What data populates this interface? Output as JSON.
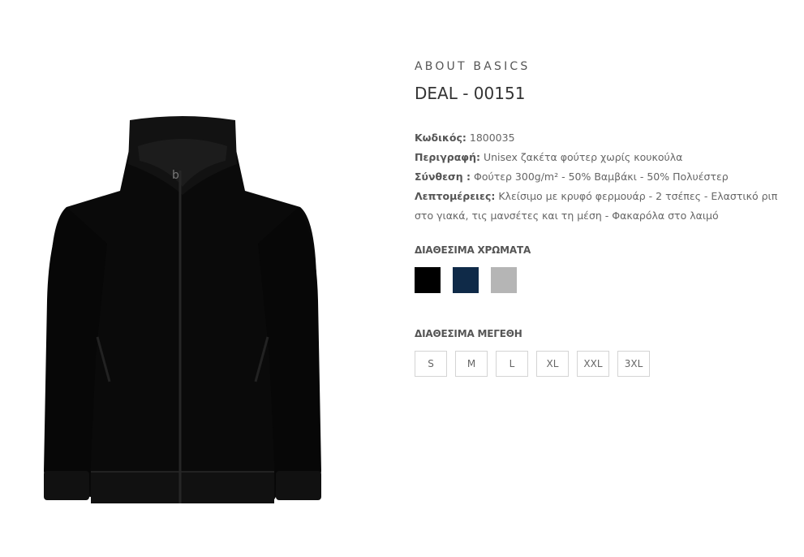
{
  "product": {
    "brand": "ABOUT BASICS",
    "title": "DEAL - 00151",
    "image_alt": "Black zip-up sweatshirt jacket"
  },
  "specs": [
    {
      "label": "Κωδικός:",
      "value": " 1800035"
    },
    {
      "label": "Περιγραφή:",
      "value": " Unisex ζακέτα φούτερ χωρίς κουκούλα"
    },
    {
      "label": "Σύνθεση :",
      "value": " Φούτερ 300g/m² - 50% Βαμβάκι - 50% Πολυέστερ"
    },
    {
      "label": "Λεπτομέρειες:",
      "value": " Κλείσιμο με κρυφό φερμουάρ - 2 τσέπες - Ελαστικό ριπ στο γιακά, τις μανσέτες και τη μέση - Φακαρόλα στο λαιμό"
    }
  ],
  "colors": {
    "title": "ΔΙΑΘΕΣΙΜΑ ΧΡΩΜΑΤΑ",
    "swatches": [
      {
        "name": "black",
        "hex": "#000000"
      },
      {
        "name": "navy",
        "hex": "#0f2a48"
      },
      {
        "name": "heather-grey",
        "hex": "#b5b5b5"
      }
    ]
  },
  "sizes": {
    "title": "ΔΙΑΘΕΣΙΜΑ ΜΕΓΕΘΗ",
    "options": [
      "S",
      "M",
      "L",
      "XL",
      "XXL",
      "3XL"
    ]
  }
}
